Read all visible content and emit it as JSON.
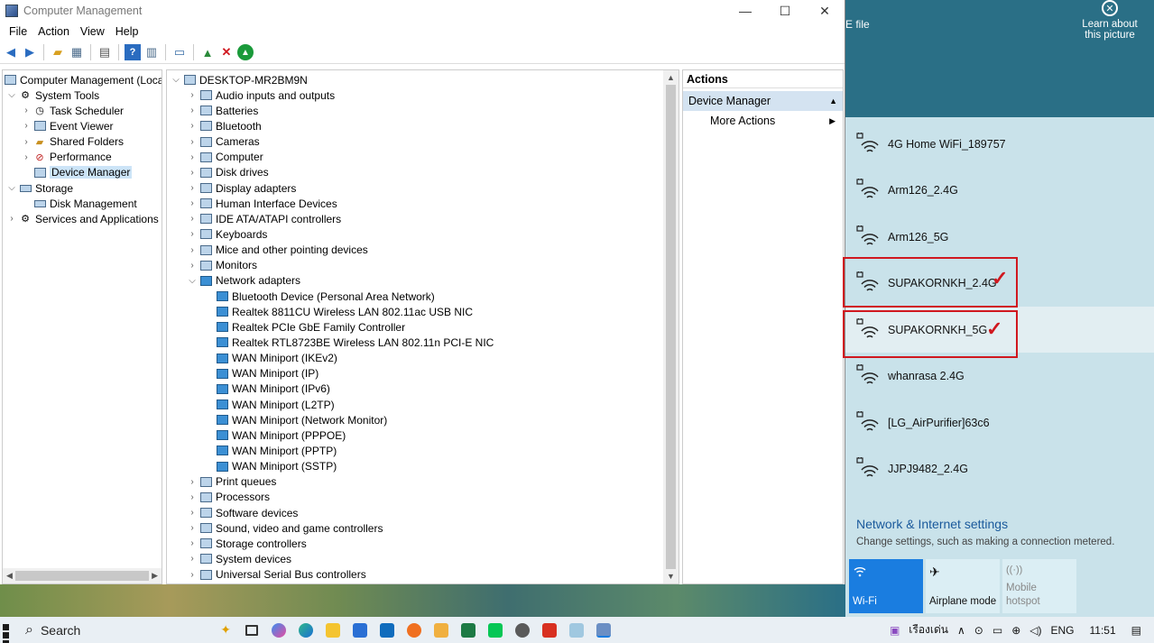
{
  "window": {
    "title": "Computer Management",
    "controls": {
      "minimize": "—",
      "maximize": "☐",
      "close": "✕"
    }
  },
  "menu": [
    "File",
    "Action",
    "View",
    "Help"
  ],
  "left_tree": {
    "root": "Computer Management (Local",
    "items": [
      {
        "label": "System Tools",
        "level": 1,
        "expanded": true
      },
      {
        "label": "Task Scheduler",
        "level": 2
      },
      {
        "label": "Event Viewer",
        "level": 2
      },
      {
        "label": "Shared Folders",
        "level": 2
      },
      {
        "label": "Performance",
        "level": 2
      },
      {
        "label": "Device Manager",
        "level": 2,
        "selected": true
      },
      {
        "label": "Storage",
        "level": 1,
        "expanded": true
      },
      {
        "label": "Disk Management",
        "level": 2
      },
      {
        "label": "Services and Applications",
        "level": 1
      }
    ]
  },
  "device_tree": {
    "root": "DESKTOP-MR2BM9N",
    "categories_before": [
      "Audio inputs and outputs",
      "Batteries",
      "Bluetooth",
      "Cameras",
      "Computer",
      "Disk drives",
      "Display adapters",
      "Human Interface Devices",
      "IDE ATA/ATAPI controllers",
      "Keyboards",
      "Mice and other pointing devices",
      "Monitors"
    ],
    "network_adapters": {
      "label": "Network adapters",
      "children": [
        "Bluetooth Device (Personal Area Network)",
        "Realtek 8811CU Wireless LAN 802.11ac USB NIC",
        "Realtek PCIe GbE Family Controller",
        "Realtek RTL8723BE Wireless LAN 802.11n PCI-E NIC",
        "WAN Miniport (IKEv2)",
        "WAN Miniport (IP)",
        "WAN Miniport (IPv6)",
        "WAN Miniport (L2TP)",
        "WAN Miniport (Network Monitor)",
        "WAN Miniport (PPPOE)",
        "WAN Miniport (PPTP)",
        "WAN Miniport (SSTP)"
      ]
    },
    "categories_after": [
      "Print queues",
      "Processors",
      "Software devices",
      "Sound, video and game controllers",
      "Storage controllers",
      "System devices",
      "Universal Serial Bus controllers"
    ]
  },
  "actions": {
    "header": "Actions",
    "section": "Device Manager",
    "more": "More Actions"
  },
  "desktop": {
    "file_label": "E file",
    "learn_line1": "Learn about",
    "learn_line2": "this picture"
  },
  "wifi": {
    "networks": [
      {
        "name": "4G Home WiFi_189757"
      },
      {
        "name": "Arm126_2.4G"
      },
      {
        "name": "Arm126_5G"
      },
      {
        "name": "SUPAKORNKH_2.4G",
        "marked": true
      },
      {
        "name": "SUPAKORNKH_5G",
        "marked": true,
        "hovered": true
      },
      {
        "name": "whanrasa 2.4G"
      },
      {
        "name": "[LG_AirPurifier]63c6"
      },
      {
        "name": "JJPJ9482_2.4G"
      }
    ],
    "settings_link": "Network & Internet settings",
    "settings_sub": "Change settings, such as making a connection metered.",
    "tiles": {
      "wifi": "Wi-Fi",
      "airplane": "Airplane mode",
      "hotspot_line1": "Mobile",
      "hotspot_line2": "hotspot"
    }
  },
  "taskbar": {
    "search_label": "Search",
    "language_thai": "เรืองเด่น",
    "lang": "ENG",
    "time": "11:51"
  },
  "colors": {
    "selection": "#cce4f7",
    "wifi_tile": "#1a7de0",
    "mark_red": "#d0181f",
    "link_blue": "#1a5a9c"
  }
}
